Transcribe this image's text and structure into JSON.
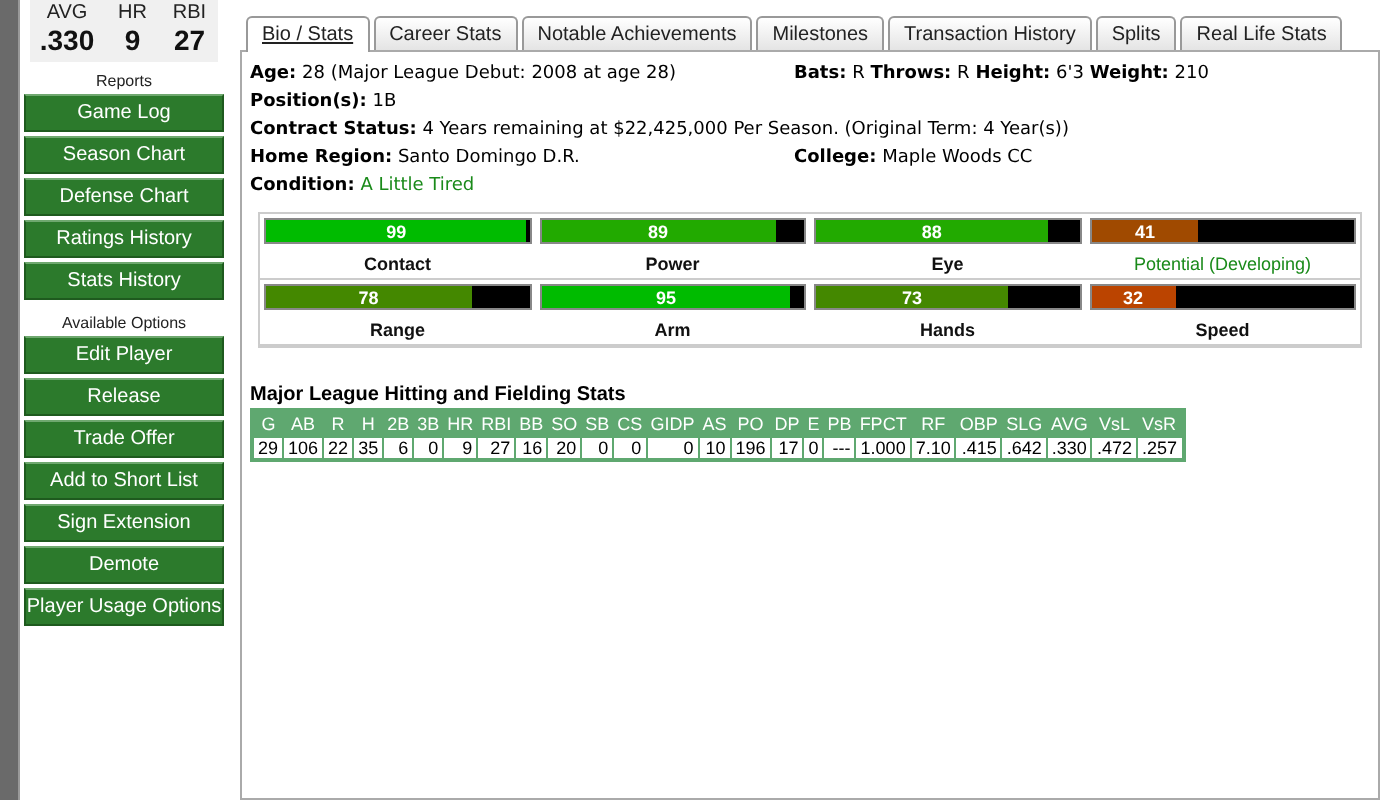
{
  "summary": [
    {
      "label": "AVG",
      "value": ".330"
    },
    {
      "label": "HR",
      "value": "9"
    },
    {
      "label": "RBI",
      "value": "27"
    }
  ],
  "sidebar": [
    {
      "kind": "heading",
      "label": "Reports"
    },
    {
      "kind": "button",
      "label": "Game Log"
    },
    {
      "kind": "button",
      "label": "Season Chart"
    },
    {
      "kind": "button",
      "label": "Defense Chart"
    },
    {
      "kind": "button",
      "label": "Ratings History"
    },
    {
      "kind": "button",
      "label": "Stats History"
    },
    {
      "kind": "heading",
      "label": "Available Options"
    },
    {
      "kind": "button",
      "label": "Edit Player"
    },
    {
      "kind": "button",
      "label": "Release"
    },
    {
      "kind": "button",
      "label": "Trade Offer"
    },
    {
      "kind": "button",
      "label": "Add to Short List"
    },
    {
      "kind": "button",
      "label": "Sign Extension"
    },
    {
      "kind": "button",
      "label": "Demote"
    },
    {
      "kind": "button",
      "label": "Player Usage Options"
    }
  ],
  "tabs": [
    {
      "label": "Bio / Stats",
      "selected": true
    },
    {
      "label": "Career Stats",
      "selected": false
    },
    {
      "label": "Notable Achievements",
      "selected": false
    },
    {
      "label": "Milestones",
      "selected": false
    },
    {
      "label": "Transaction History",
      "selected": false
    },
    {
      "label": "Splits",
      "selected": false
    },
    {
      "label": "Real Life Stats",
      "selected": false
    }
  ],
  "bio": {
    "age_label": "Age:",
    "age": "28  (Major League Debut: 2008 at age 28)",
    "bats_label": "Bats:",
    "bats": "R",
    "throws_label": "Throws:",
    "throws": "R",
    "height_label": "Height:",
    "height": "6'3",
    "weight_label": "Weight:",
    "weight": "210",
    "position_label": "Position(s):",
    "position": "1B",
    "contract_label": "Contract Status:",
    "contract": "4 Years remaining at $22,425,000 Per Season. (Original Term: 4 Year(s))",
    "home_label": "Home Region:",
    "home": "Santo Domingo  D.R.",
    "college_label": "College:",
    "college": "Maple Woods CC",
    "condition_label": "Condition:",
    "condition": "A Little Tired"
  },
  "ratings": [
    {
      "name": "Contact",
      "value": "99",
      "level": 0.99,
      "color": "#00bb00",
      "highlight": false
    },
    {
      "name": "Power",
      "value": "89",
      "level": 0.89,
      "color": "#22aa00",
      "highlight": false
    },
    {
      "name": "Eye",
      "value": "88",
      "level": 0.88,
      "color": "#22aa00",
      "highlight": false
    },
    {
      "name": "Potential (Developing)",
      "value": "41",
      "level": 0.41,
      "color": "#a04a00",
      "highlight": true
    },
    {
      "name": "Range",
      "value": "78",
      "level": 0.78,
      "color": "#448800",
      "highlight": false
    },
    {
      "name": "Arm",
      "value": "95",
      "level": 0.95,
      "color": "#00bb00",
      "highlight": false
    },
    {
      "name": "Hands",
      "value": "73",
      "level": 0.73,
      "color": "#448800",
      "highlight": false
    },
    {
      "name": "Speed",
      "value": "32",
      "level": 0.32,
      "color": "#bb4400",
      "highlight": false
    }
  ],
  "stats": {
    "title": "Major League Hitting and Fielding Stats",
    "columns": [
      "G",
      "AB",
      "R",
      "H",
      "2B",
      "3B",
      "HR",
      "RBI",
      "BB",
      "SO",
      "SB",
      "CS",
      "GIDP",
      "AS",
      "PO",
      "DP",
      "E",
      "PB",
      "FPCT",
      "RF",
      "OBP",
      "SLG",
      "AVG",
      "VsL",
      "VsR"
    ],
    "rows": [
      [
        "29",
        "106",
        "22",
        "35",
        "6",
        "0",
        "9",
        "27",
        "16",
        "20",
        "0",
        "0",
        "0",
        "10",
        "196",
        "17",
        "0",
        "---",
        "1.000",
        "7.10",
        ".415",
        ".642",
        ".330",
        ".472",
        ".257"
      ]
    ]
  }
}
